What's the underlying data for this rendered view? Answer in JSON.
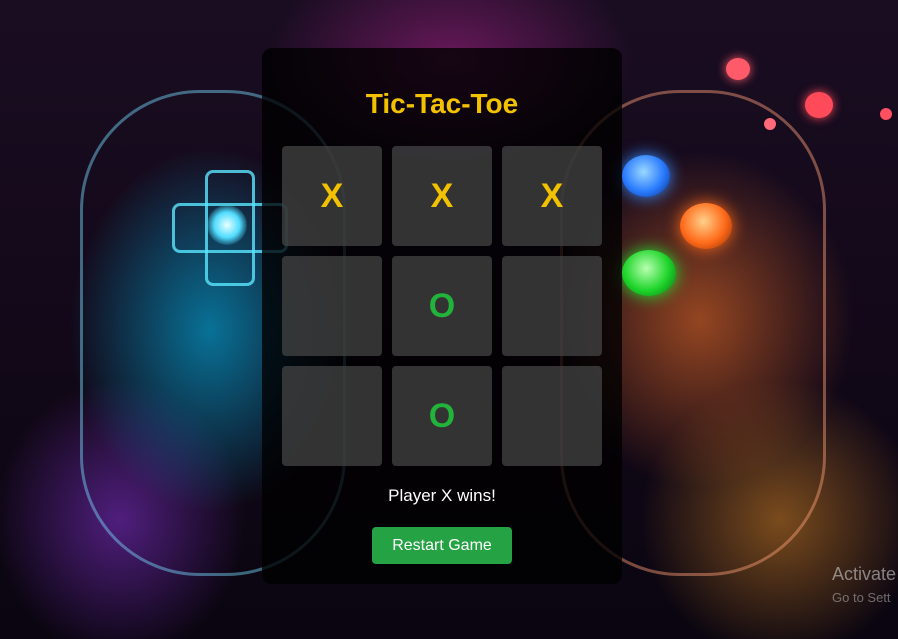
{
  "game": {
    "title": "Tic-Tac-Toe",
    "board": [
      "X",
      "X",
      "X",
      "",
      "O",
      "",
      "",
      "O",
      ""
    ],
    "status": "Player X wins!",
    "restart_label": "Restart Game"
  },
  "watermark": {
    "line1": "Activate",
    "line2": "Go to Sett"
  },
  "colors": {
    "x_mark": "#f2c200",
    "o_mark": "#22b33a",
    "restart_button": "#25a244"
  }
}
